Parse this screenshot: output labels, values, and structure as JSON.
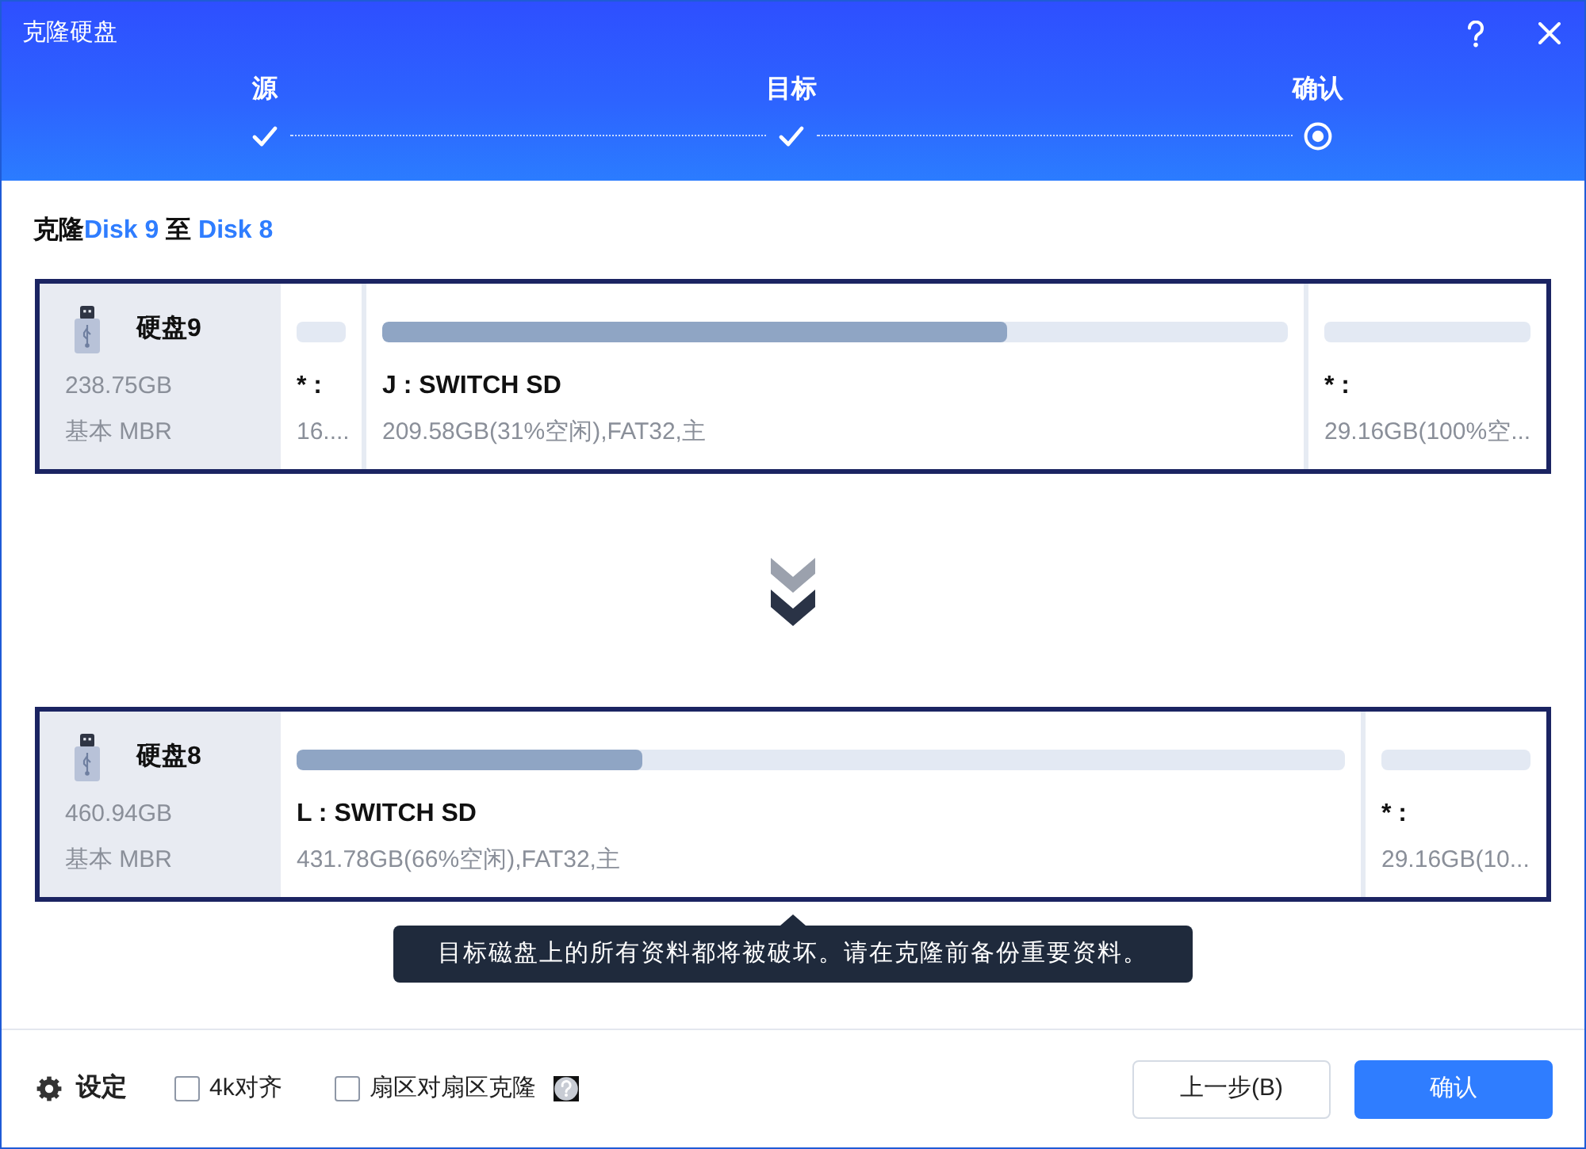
{
  "window": {
    "title": "克隆硬盘"
  },
  "steps": [
    {
      "label": "源",
      "completed": true
    },
    {
      "label": "目标",
      "completed": true
    },
    {
      "label": "确认",
      "completed": false
    }
  ],
  "heading": {
    "prefix": "克隆",
    "source": "Disk 9",
    "joiner": "至",
    "target": "Disk 8"
  },
  "disks": [
    {
      "name": "硬盘9",
      "size": "238.75GB",
      "type": "基本 MBR",
      "partitions": [
        {
          "label": "* :",
          "detail": "16...."
        },
        {
          "label": "J : SWITCH SD",
          "detail": "209.58GB(31%空闲),FAT32,主",
          "level": 0.69
        },
        {
          "label": "* :",
          "detail": "29.16GB(100%空..."
        }
      ]
    },
    {
      "name": "硬盘8",
      "size": "460.94GB",
      "type": "基本 MBR",
      "partitions": [
        {
          "label": "L : SWITCH SD",
          "detail": "431.78GB(66%空闲),FAT32,主",
          "level": 0.33
        },
        {
          "label": "* :",
          "detail": "29.16GB(10..."
        }
      ]
    }
  ],
  "warning_tooltip": "目标磁盘上的所有资料都将被破坏。请在克隆前备份重要资料。",
  "footer": {
    "settings": "设定",
    "options": [
      {
        "label": "4k对齐",
        "checked": false,
        "help": false
      },
      {
        "label": "扇区对扇区克隆",
        "checked": false,
        "help": true
      }
    ],
    "buttons": [
      {
        "label": "上一步(B)",
        "kind": "secondary"
      },
      {
        "label": "确认",
        "kind": "primary"
      }
    ]
  }
}
